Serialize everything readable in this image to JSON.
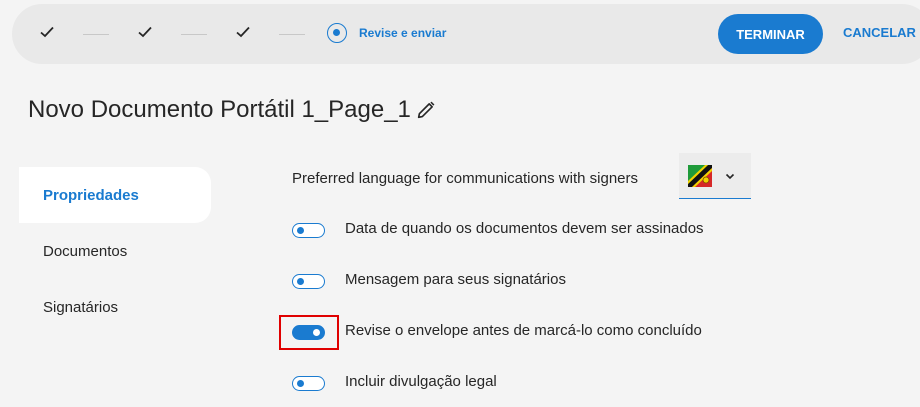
{
  "stepper": {
    "completed_steps": 3,
    "current_step_label": "Revise e enviar"
  },
  "header": {
    "finish_label": "TERMINAR",
    "cancel_label": "CANCELAR"
  },
  "document": {
    "title": "Novo Documento Portátil 1_Page_1"
  },
  "sidebar": {
    "items": [
      {
        "label": "Propriedades",
        "active": true
      },
      {
        "label": "Documentos",
        "active": false
      },
      {
        "label": "Signatários",
        "active": false
      }
    ]
  },
  "properties": {
    "language_label": "Preferred language for communications with signers",
    "language_flag_icon": "flag-icon",
    "toggles": [
      {
        "label": "Data de quando os documentos devem ser assinados",
        "on": false
      },
      {
        "label": "Mensagem para seus signatários",
        "on": false
      },
      {
        "label": "Revise o envelope antes de marcá-lo como concluído",
        "on": true
      },
      {
        "label": "Incluir divulgação legal",
        "on": false
      }
    ]
  },
  "colors": {
    "accent": "#1a7bd0",
    "highlight": "#e00000",
    "topbar": "#e9e9e9",
    "background": "#f4f4f4"
  }
}
